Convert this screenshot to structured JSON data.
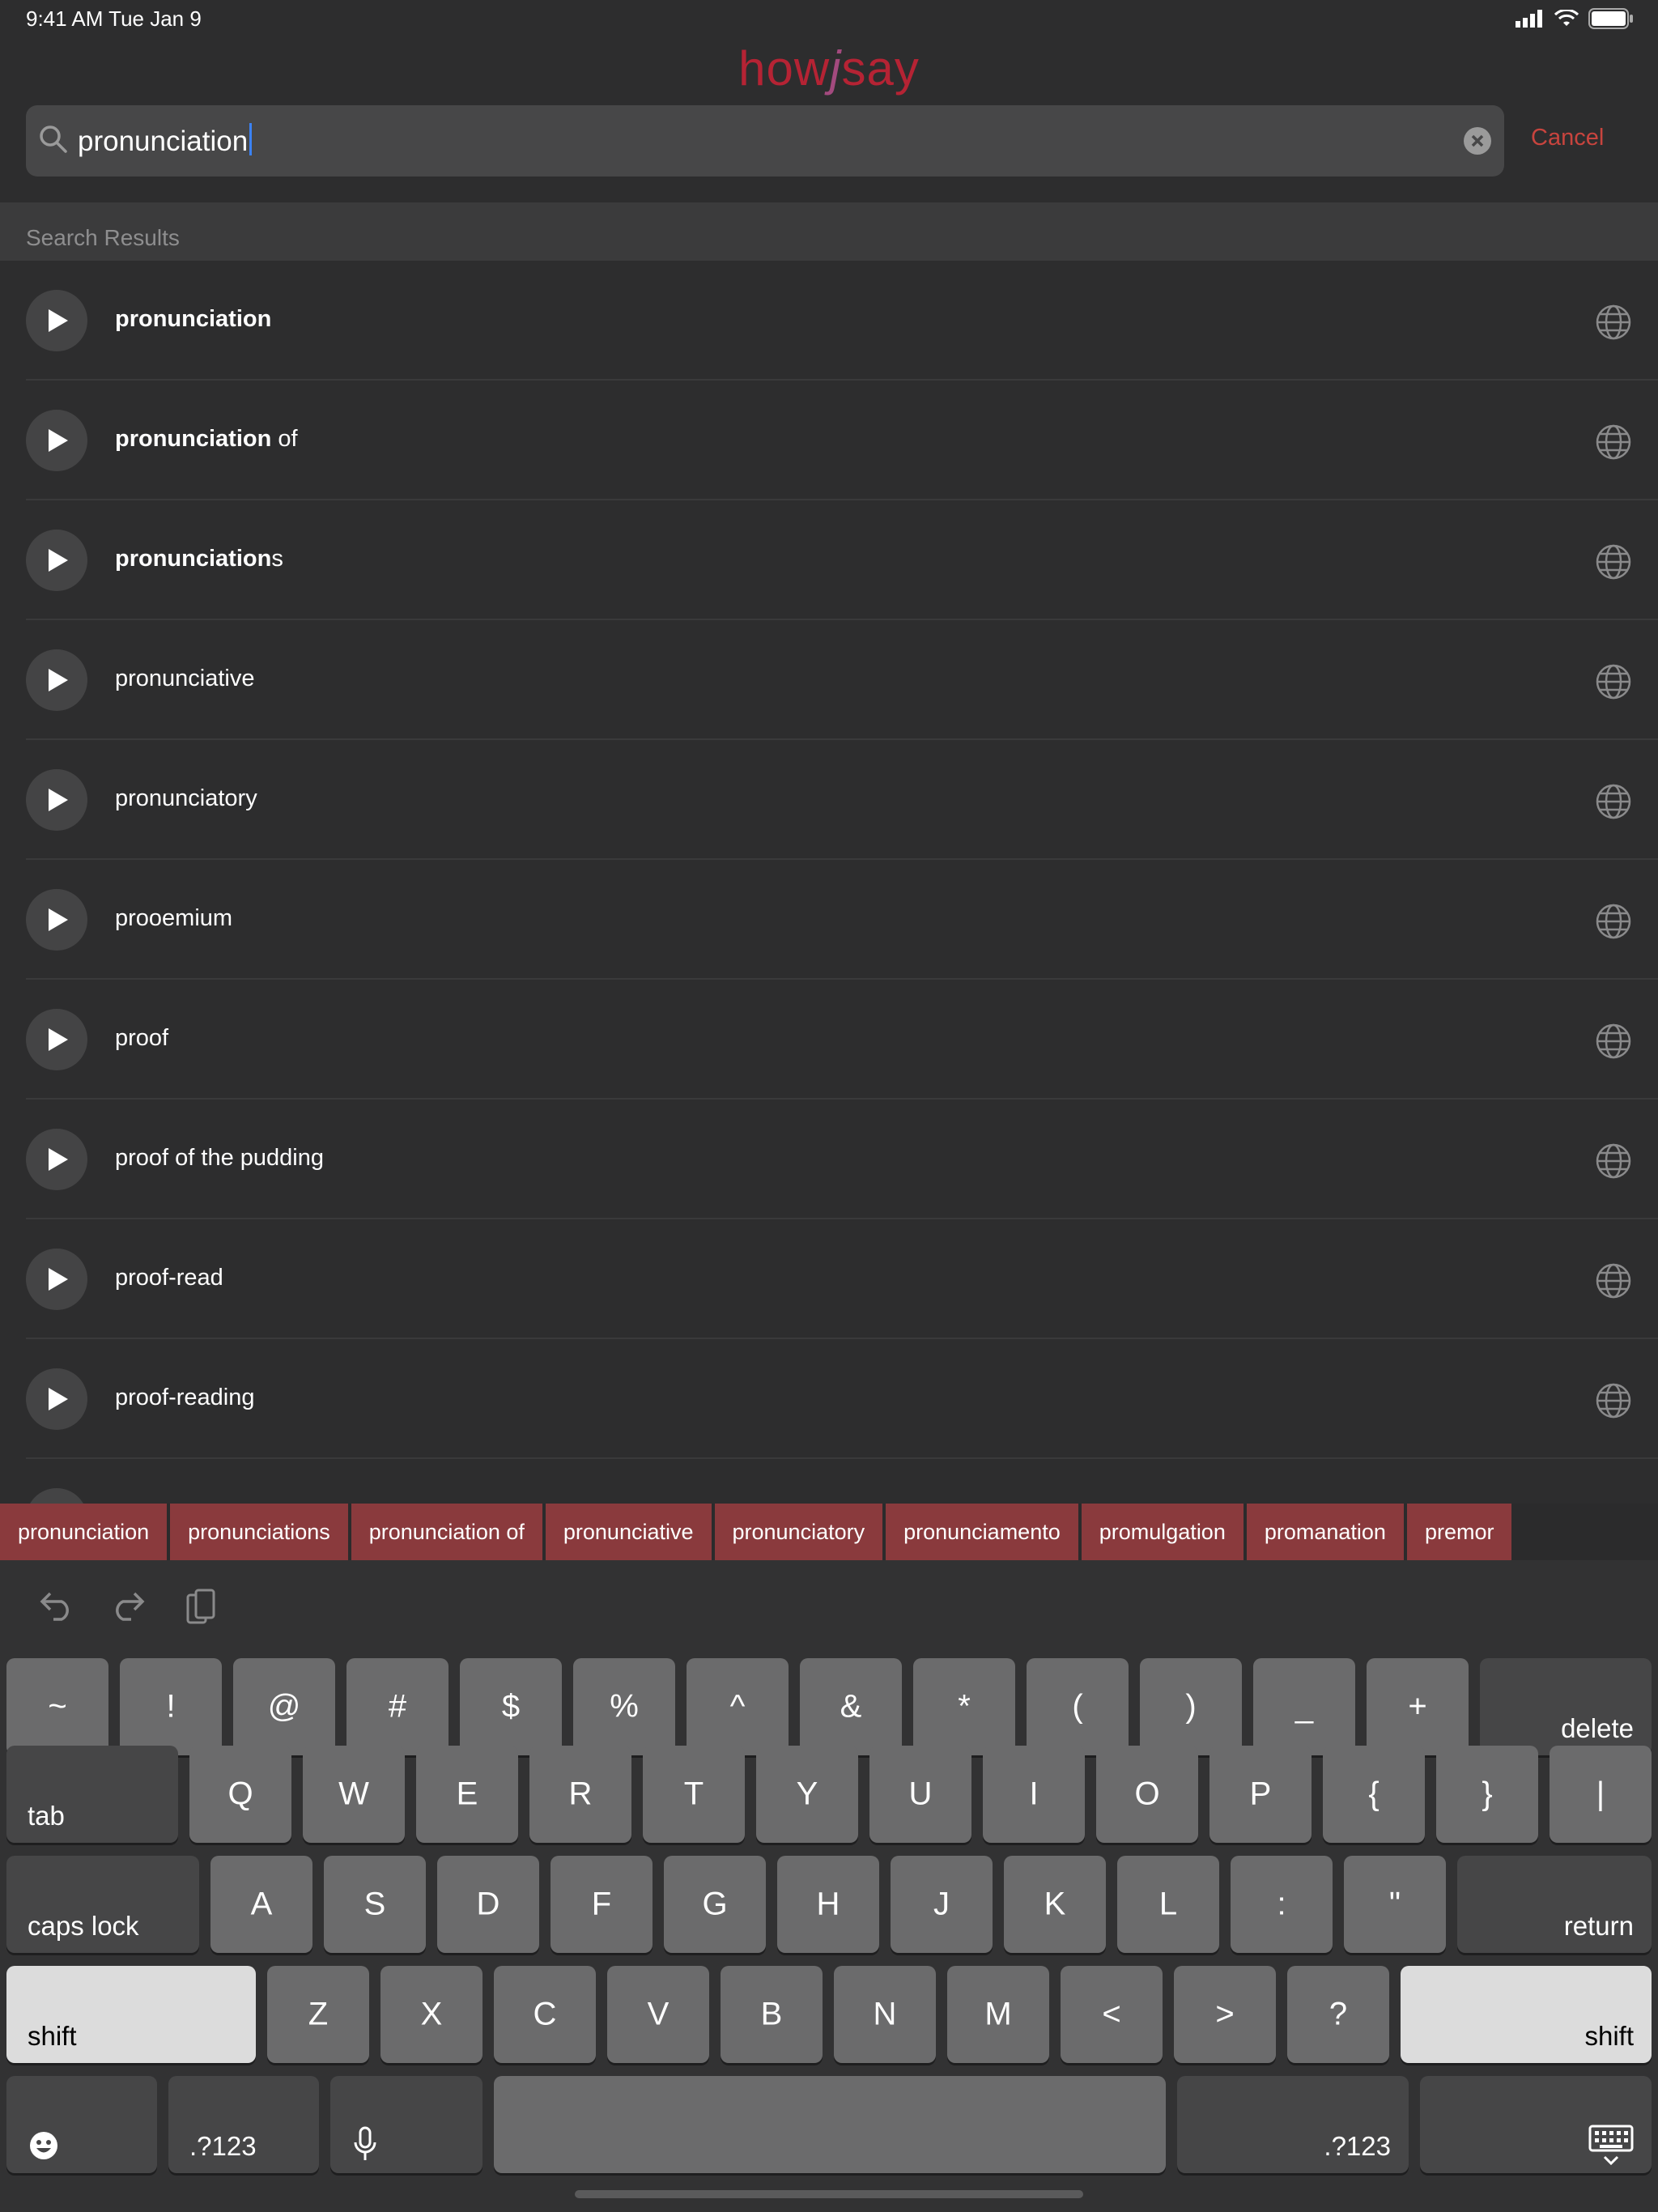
{
  "status": {
    "time": "9:41 AM   Tue Jan 9"
  },
  "header": {
    "logo_a": "how",
    "logo_j": "j",
    "logo_b": "say",
    "search_query": "pronunciation",
    "cancel_label": "Cancel"
  },
  "section_label": "Search Results",
  "results": [
    {
      "bold": "pronunciation",
      "rest": ""
    },
    {
      "bold": "pronunciation",
      "rest": " of"
    },
    {
      "bold": "pronunciation",
      "rest": "s"
    },
    {
      "bold": "",
      "rest": "pronunciative"
    },
    {
      "bold": "",
      "rest": "pronunciatory"
    },
    {
      "bold": "",
      "rest": "prooemium"
    },
    {
      "bold": "",
      "rest": "proof"
    },
    {
      "bold": "",
      "rest": "proof of the pudding"
    },
    {
      "bold": "",
      "rest": "proof-read"
    },
    {
      "bold": "",
      "rest": "proof-reading"
    }
  ],
  "suggestions": [
    "pronunciation",
    "pronunciations",
    "pronunciation of",
    "pronunciative",
    "pronunciatory",
    "pronunciamento",
    "promulgation",
    "promanation",
    "premor"
  ],
  "keyboard": {
    "row1": [
      "~",
      "!",
      "@",
      "#",
      "$",
      "%",
      "^",
      "&",
      "*",
      "(",
      ")",
      "_",
      "+"
    ],
    "delete": "delete",
    "tab": "tab",
    "row2": [
      "Q",
      "W",
      "E",
      "R",
      "T",
      "Y",
      "U",
      "I",
      "O",
      "P",
      "{",
      "}",
      "|"
    ],
    "caps": "caps lock",
    "row3": [
      "A",
      "S",
      "D",
      "F",
      "G",
      "H",
      "J",
      "K",
      "L",
      ":",
      "\""
    ],
    "return": "return",
    "shift": "shift",
    "row4": [
      "Z",
      "X",
      "C",
      "V",
      "B",
      "N",
      "M",
      "<",
      ">",
      "?"
    ],
    "num": ".?123"
  },
  "colors": {
    "brand": "#b52334",
    "accent": "#c8443e",
    "chip": "#8a3a3d"
  }
}
